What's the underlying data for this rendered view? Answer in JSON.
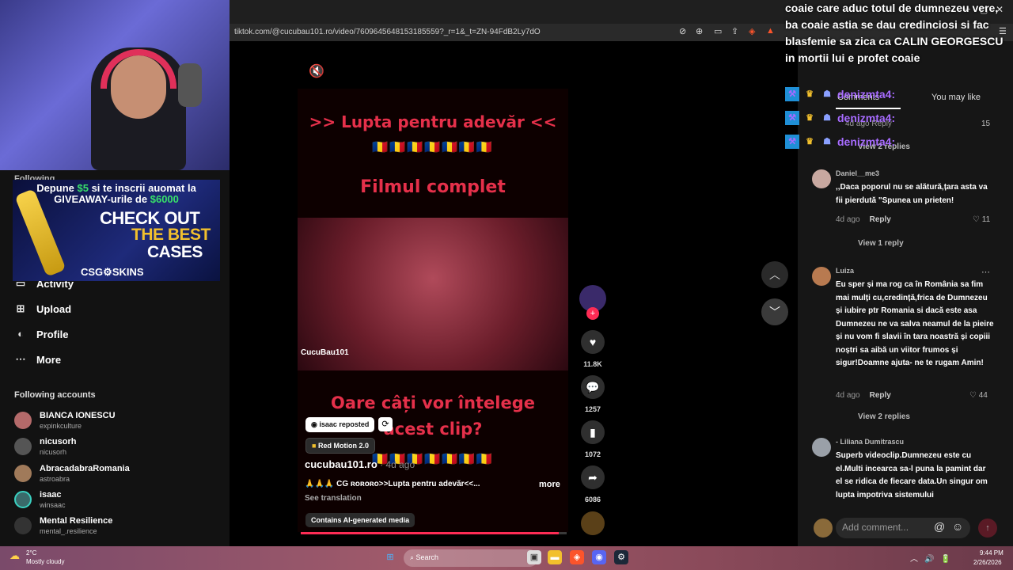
{
  "browser": {
    "url": "tiktok.com/@cucubau101.ro/video/7609645648153185559?_r=1&_t=ZN-94FdB2Ly7dO"
  },
  "overlay_ad": {
    "line1_a": "Depune",
    "line1_amount": "$5",
    "line1_b": "si te inscrii auomat la",
    "line2_a": "GIVEAWAY-urile de",
    "line2_amount": "$6000",
    "check": "CHECK OUT",
    "best": "THE BEST",
    "cases": "CASES",
    "brand": "CSG⚙SKINS"
  },
  "stream_chat": {
    "message": "coaie care aduc totul de dumnezeu vere, ba coaie astia se dau credinciosi si fac blasfemie sa zica ca CALIN GEORGESCU in mortii lui e profet coaie",
    "lines": [
      {
        "user": "denizmta4:"
      },
      {
        "user": "denizmta4:"
      },
      {
        "user": "denizmta4:"
      }
    ]
  },
  "sidebar": {
    "following_partial": "Following",
    "nav": [
      {
        "label": "Activity",
        "icon": "inbox-icon"
      },
      {
        "label": "Upload",
        "icon": "upload-icon"
      },
      {
        "label": "Profile",
        "icon": "profile-icon"
      },
      {
        "label": "More",
        "icon": "more-icon"
      }
    ],
    "following_title": "Following accounts",
    "accounts": [
      {
        "name": "BIANCA IONESCU",
        "handle": "expinkculture"
      },
      {
        "name": "nicusorh",
        "handle": "nicusorh"
      },
      {
        "name": "AbracadabraRomania",
        "handle": "astroabra"
      },
      {
        "name": "isaac",
        "handle": "winsaac"
      },
      {
        "name": "Mental Resilience",
        "handle": "mental_.resilience"
      }
    ]
  },
  "video": {
    "heading": ">> Lupta pentru adevăr <<",
    "flags": "🇷🇴🇷🇴🇷🇴🇷🇴🇷🇴🇷🇴🇷🇴",
    "film": "Filmul complet",
    "watermark": "CucuBau101",
    "question_1": "Oare câți vor înțelege",
    "question_2": "acest clip?",
    "flags_2": "🇷🇴🇷🇴🇷🇴🇷🇴🇷🇴🇷🇴🇷🇴",
    "repost": "isaac reposted",
    "effect": "Red Motion 2.0",
    "author": "cucubau101.ro",
    "date": " · 4d ago",
    "caption": "🙏🙏🙏 CG ʀᴏʀᴏʀᴏ>>Lupta pentru adevăr<<...",
    "more": "more",
    "translate": "See translation",
    "ai_label": "Contains AI-generated media",
    "progress": 0.97
  },
  "actions": {
    "likes": "11.8K",
    "comments": "1257",
    "saves": "1072",
    "shares": "6086"
  },
  "comments_panel": {
    "tab_comments": "Comments",
    "tab_you_may_like": "You may like",
    "partial_reply": "4d ago   Reply",
    "partial_likes": "15",
    "partial_view": "View 2 replies",
    "comments": [
      {
        "author": "Daniel__me3",
        "text": ",,Daca poporul nu se alătură,țara asta va fii pierdută \"Spunea un prieten!",
        "date": "4d ago",
        "reply": "Reply",
        "likes": "11",
        "view_replies": "View 1 reply"
      },
      {
        "author": "Luiza",
        "text": "Eu sper și ma rog ca în România sa fim mai mulți cu,credință,frica de Dumnezeu și iubire ptr Romania si dacă este asa Dumnezeu ne va salva neamul de la pieire și nu vom fi slavii în tara noastră și copiii noștri sa aibă un viitor frumos și sigur!Doamne ajuta- ne te rugam Amin!",
        "date": "4d ago",
        "reply": "Reply",
        "likes": "44",
        "view_replies": "View 2 replies"
      },
      {
        "author": "- Liliana Dumitrascu",
        "text": "Superb videoclip.Dumnezeu este cu el.Multi incearca sa-l puna la pamint dar el se ridica de fiecare data.Un singur om lupta impotriva sistemului",
        "date": "",
        "reply": "",
        "likes": "",
        "view_replies": ""
      }
    ],
    "add_comment_placeholder": "Add comment..."
  },
  "taskbar": {
    "temp": "2°C",
    "weather": "Mostly cloudy",
    "search": "Search",
    "time": "9:44 PM",
    "date": "2/26/2026"
  },
  "colors": {
    "accent": "#fe2c55",
    "video_text": "#e5304a",
    "chat_user": "#a76bff"
  }
}
